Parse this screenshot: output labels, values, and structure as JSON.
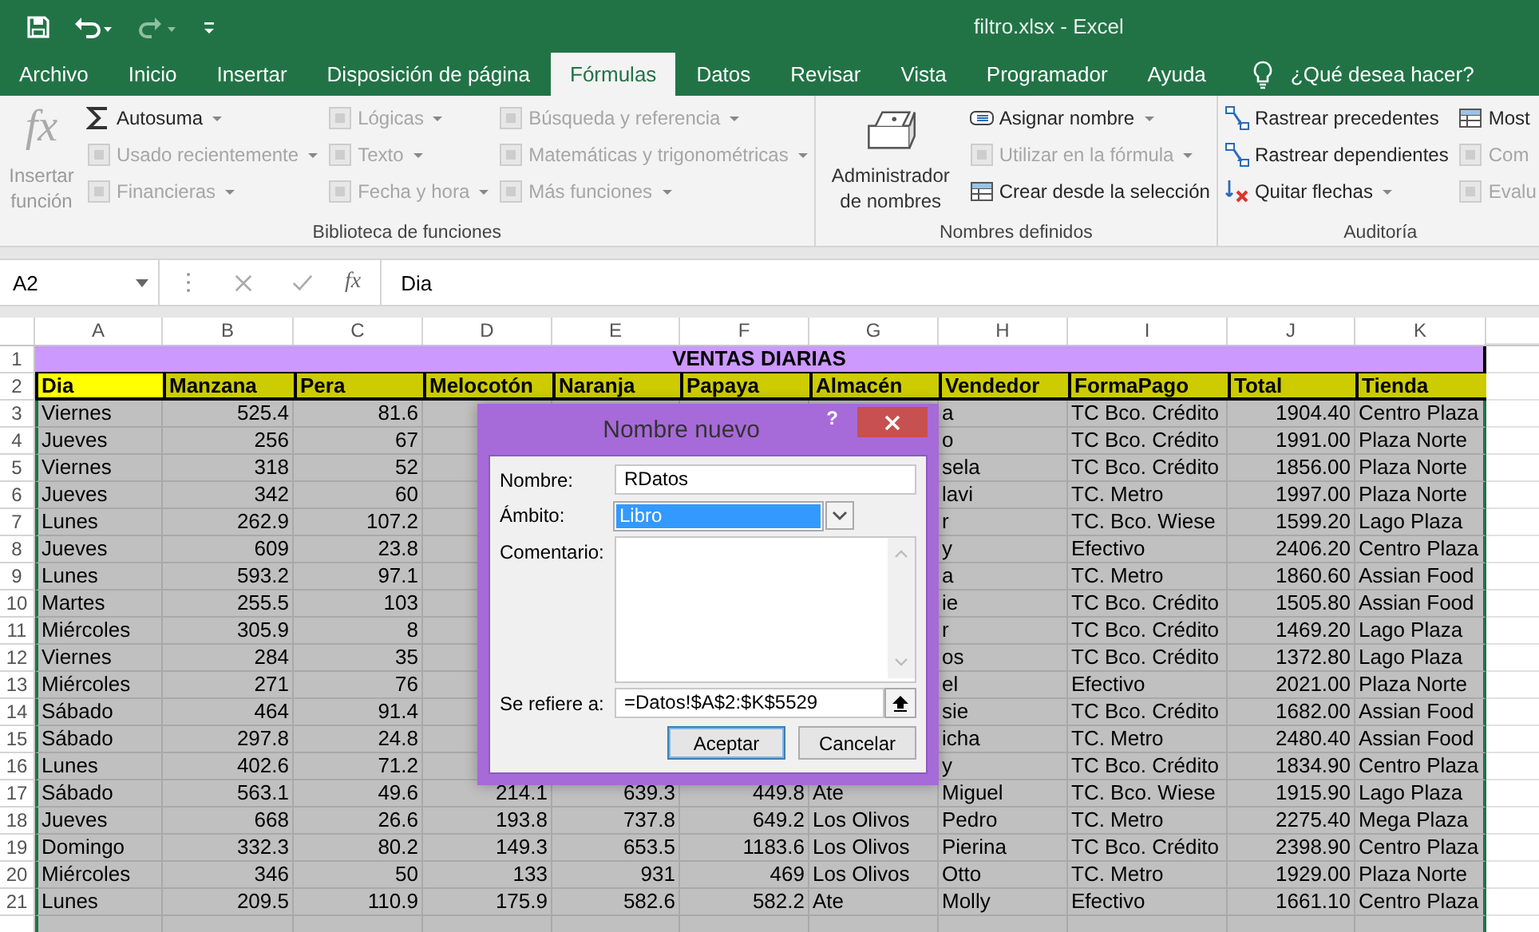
{
  "window": {
    "title": "filtro.xlsx  -  Excel"
  },
  "tabs": [
    {
      "label": "Archivo",
      "selected": false
    },
    {
      "label": "Inicio",
      "selected": false
    },
    {
      "label": "Insertar",
      "selected": false
    },
    {
      "label": "Disposición de página",
      "selected": false
    },
    {
      "label": "Fórmulas",
      "selected": true
    },
    {
      "label": "Datos",
      "selected": false
    },
    {
      "label": "Revisar",
      "selected": false
    },
    {
      "label": "Vista",
      "selected": false
    },
    {
      "label": "Programador",
      "selected": false
    },
    {
      "label": "Ayuda",
      "selected": false
    }
  ],
  "tell_me": {
    "label": "¿Qué desea hacer?"
  },
  "ribbon": {
    "groups": [
      {
        "label": "Biblioteca de funciones",
        "large": [
          {
            "kind": "function",
            "icon_text": "fx",
            "label": "Insertar función",
            "disabled": true
          }
        ],
        "columns": [
          [
            {
              "kind": "sum",
              "label": "Autosuma",
              "disabled": false,
              "dropdown": true
            },
            {
              "kind": "tile",
              "label": "Usado recientemente",
              "disabled": true,
              "dropdown": true
            },
            {
              "kind": "tile",
              "label": "Financieras",
              "disabled": true,
              "dropdown": true
            }
          ],
          [
            {
              "kind": "tile",
              "label": "Lógicas",
              "disabled": true,
              "dropdown": true
            },
            {
              "kind": "tile",
              "label": "Texto",
              "disabled": true,
              "dropdown": true
            },
            {
              "kind": "tile",
              "label": "Fecha y hora",
              "disabled": true,
              "dropdown": true
            }
          ],
          [
            {
              "kind": "tile",
              "label": "Búsqueda y referencia",
              "disabled": true,
              "dropdown": true
            },
            {
              "kind": "tile",
              "label": "Matemáticas y trigonométricas",
              "disabled": true,
              "dropdown": true
            },
            {
              "kind": "tile",
              "label": "Más funciones",
              "disabled": true,
              "dropdown": true
            }
          ]
        ]
      },
      {
        "label": "Nombres definidos",
        "large": [
          {
            "kind": "manager",
            "label": "Administrador de nombres",
            "disabled": false
          }
        ],
        "columns": [
          [
            {
              "kind": "label",
              "label": "Asignar nombre",
              "disabled": false,
              "dropdown": true
            },
            {
              "kind": "tile",
              "label": "Utilizar en la fórmula",
              "disabled": true,
              "dropdown": true
            },
            {
              "kind": "table",
              "label": "Crear desde la selección",
              "disabled": false,
              "dropdown": false
            }
          ]
        ]
      },
      {
        "label": "Auditoría",
        "columns": [
          [
            {
              "kind": "trace",
              "label": "Rastrear precedentes",
              "disabled": false,
              "dropdown": false
            },
            {
              "kind": "trace",
              "label": "Rastrear dependientes",
              "disabled": false,
              "dropdown": false
            },
            {
              "kind": "remove",
              "label": "Quitar flechas",
              "disabled": false,
              "dropdown": true
            }
          ],
          [
            {
              "kind": "table",
              "label": "Most",
              "disabled": false,
              "dropdown": false
            },
            {
              "kind": "tile",
              "label": "Com",
              "disabled": true,
              "dropdown": false
            },
            {
              "kind": "tile",
              "label": "Evalu",
              "disabled": true,
              "dropdown": false
            }
          ]
        ]
      }
    ]
  },
  "formula_bar": {
    "name_box": "A2",
    "insert_function": "fx",
    "value": "Dia"
  },
  "grid": {
    "columns": [
      {
        "letter": "A",
        "numeric": false
      },
      {
        "letter": "B",
        "numeric": true
      },
      {
        "letter": "C",
        "numeric": true
      },
      {
        "letter": "D",
        "numeric": true
      },
      {
        "letter": "E",
        "numeric": true
      },
      {
        "letter": "F",
        "numeric": true
      },
      {
        "letter": "G",
        "numeric": false
      },
      {
        "letter": "H",
        "numeric": false
      },
      {
        "letter": "I",
        "numeric": false
      },
      {
        "letter": "J",
        "numeric": true
      },
      {
        "letter": "K",
        "numeric": false
      }
    ],
    "title_row": {
      "num": "1",
      "text": "VENTAS DIARIAS"
    },
    "header_row": {
      "num": "2",
      "cells": [
        {
          "text": "Dia",
          "selected": true
        },
        {
          "text": "Manzana",
          "selected": false
        },
        {
          "text": "Pera",
          "selected": false
        },
        {
          "text": "Melocotón",
          "selected": false
        },
        {
          "text": "Naranja",
          "selected": false
        },
        {
          "text": "Papaya",
          "selected": false
        },
        {
          "text": "Almacén",
          "selected": false
        },
        {
          "text": "Vendedor",
          "selected": false
        },
        {
          "text": "FormaPago",
          "selected": false
        },
        {
          "text": "Total",
          "selected": false
        },
        {
          "text": "Tienda",
          "selected": false
        }
      ]
    },
    "rows": [
      {
        "num": "3",
        "cells": [
          "Viernes",
          "525.4",
          "81.6"
        ],
        "after_dialog": [
          "a",
          "TC Bco. Crédito",
          "1904.40",
          "Centro Plaza"
        ]
      },
      {
        "num": "4",
        "cells": [
          "Jueves",
          "256",
          "67"
        ],
        "after_dialog": [
          "o",
          "TC Bco. Crédito",
          "1991.00",
          "Plaza Norte"
        ]
      },
      {
        "num": "5",
        "cells": [
          "Viernes",
          "318",
          "52"
        ],
        "after_dialog": [
          "sela",
          "TC Bco. Crédito",
          "1856.00",
          "Plaza Norte"
        ]
      },
      {
        "num": "6",
        "cells": [
          "Jueves",
          "342",
          "60"
        ],
        "after_dialog": [
          "lavi",
          "TC. Metro",
          "1997.00",
          "Plaza Norte"
        ]
      },
      {
        "num": "7",
        "cells": [
          "Lunes",
          "262.9",
          "107.2"
        ],
        "after_dialog": [
          "r",
          "TC. Bco. Wiese",
          "1599.20",
          "Lago Plaza"
        ]
      },
      {
        "num": "8",
        "cells": [
          "Jueves",
          "609",
          "23.8"
        ],
        "after_dialog": [
          "y",
          "Efectivo",
          "2406.20",
          "Centro Plaza"
        ]
      },
      {
        "num": "9",
        "cells": [
          "Lunes",
          "593.2",
          "97.1"
        ],
        "after_dialog": [
          "a",
          "TC. Metro",
          "1860.60",
          "Assian Food"
        ]
      },
      {
        "num": "10",
        "cells": [
          "Martes",
          "255.5",
          "103"
        ],
        "after_dialog": [
          "ie",
          "TC Bco. Crédito",
          "1505.80",
          "Assian Food"
        ]
      },
      {
        "num": "11",
        "cells": [
          "Miércoles",
          "305.9",
          "8"
        ],
        "after_dialog": [
          "r",
          "TC Bco. Crédito",
          "1469.20",
          "Lago Plaza"
        ]
      },
      {
        "num": "12",
        "cells": [
          "Viernes",
          "284",
          "35"
        ],
        "after_dialog": [
          "os",
          "TC Bco. Crédito",
          "1372.80",
          "Lago Plaza"
        ]
      },
      {
        "num": "13",
        "cells": [
          "Miércoles",
          "271",
          "76"
        ],
        "after_dialog": [
          "el",
          "Efectivo",
          "2021.00",
          "Plaza Norte"
        ]
      },
      {
        "num": "14",
        "cells": [
          "Sábado",
          "464",
          "91.4"
        ],
        "after_dialog": [
          "sie",
          "TC Bco. Crédito",
          "1682.00",
          "Assian Food"
        ]
      },
      {
        "num": "15",
        "cells": [
          "Sábado",
          "297.8",
          "24.8"
        ],
        "after_dialog": [
          "icha",
          "TC. Metro",
          "2480.40",
          "Assian Food"
        ]
      },
      {
        "num": "16",
        "cells": [
          "Lunes",
          "402.6",
          "71.2"
        ],
        "after_dialog": [
          "y",
          "TC Bco. Crédito",
          "1834.90",
          "Centro Plaza"
        ]
      },
      {
        "num": "17",
        "cells": [
          "Sábado",
          "563.1",
          "49.6",
          "214.1",
          "639.3",
          "449.8",
          "Ate",
          "Miguel",
          "TC. Bco. Wiese",
          "1915.90",
          "Lago Plaza"
        ]
      },
      {
        "num": "18",
        "cells": [
          "Jueves",
          "668",
          "26.6",
          "193.8",
          "737.8",
          "649.2",
          "Los Olivos",
          "Pedro",
          "TC. Metro",
          "2275.40",
          "Mega Plaza"
        ]
      },
      {
        "num": "19",
        "cells": [
          "Domingo",
          "332.3",
          "80.2",
          "149.3",
          "653.5",
          "1183.6",
          "Los Olivos",
          "Pierina",
          "TC Bco. Crédito",
          "2398.90",
          "Centro Plaza"
        ]
      },
      {
        "num": "20",
        "cells": [
          "Miércoles",
          "346",
          "50",
          "133",
          "931",
          "469",
          "Los Olivos",
          "Otto",
          "TC. Metro",
          "1929.00",
          "Plaza Norte"
        ]
      },
      {
        "num": "21",
        "cells": [
          "Lunes",
          "209.5",
          "110.9",
          "175.9",
          "582.6",
          "582.2",
          "Ate",
          "Molly",
          "Efectivo",
          "1661.10",
          "Centro Plaza"
        ]
      }
    ]
  },
  "dialog": {
    "title": "Nombre nuevo",
    "help": "?",
    "fields": [
      {
        "kind": "text",
        "label": "Nombre:",
        "value": "RDatos"
      },
      {
        "kind": "select",
        "label": "Ámbito:",
        "value": "Libro"
      },
      {
        "kind": "textarea",
        "label": "Comentario:"
      },
      {
        "kind": "ref",
        "label": "Se refiere a:",
        "value": "=Datos!$A$2:$K$5529"
      }
    ],
    "buttons": [
      {
        "label": "Aceptar",
        "default": true
      },
      {
        "label": "Cancelar",
        "default": false
      }
    ]
  }
}
